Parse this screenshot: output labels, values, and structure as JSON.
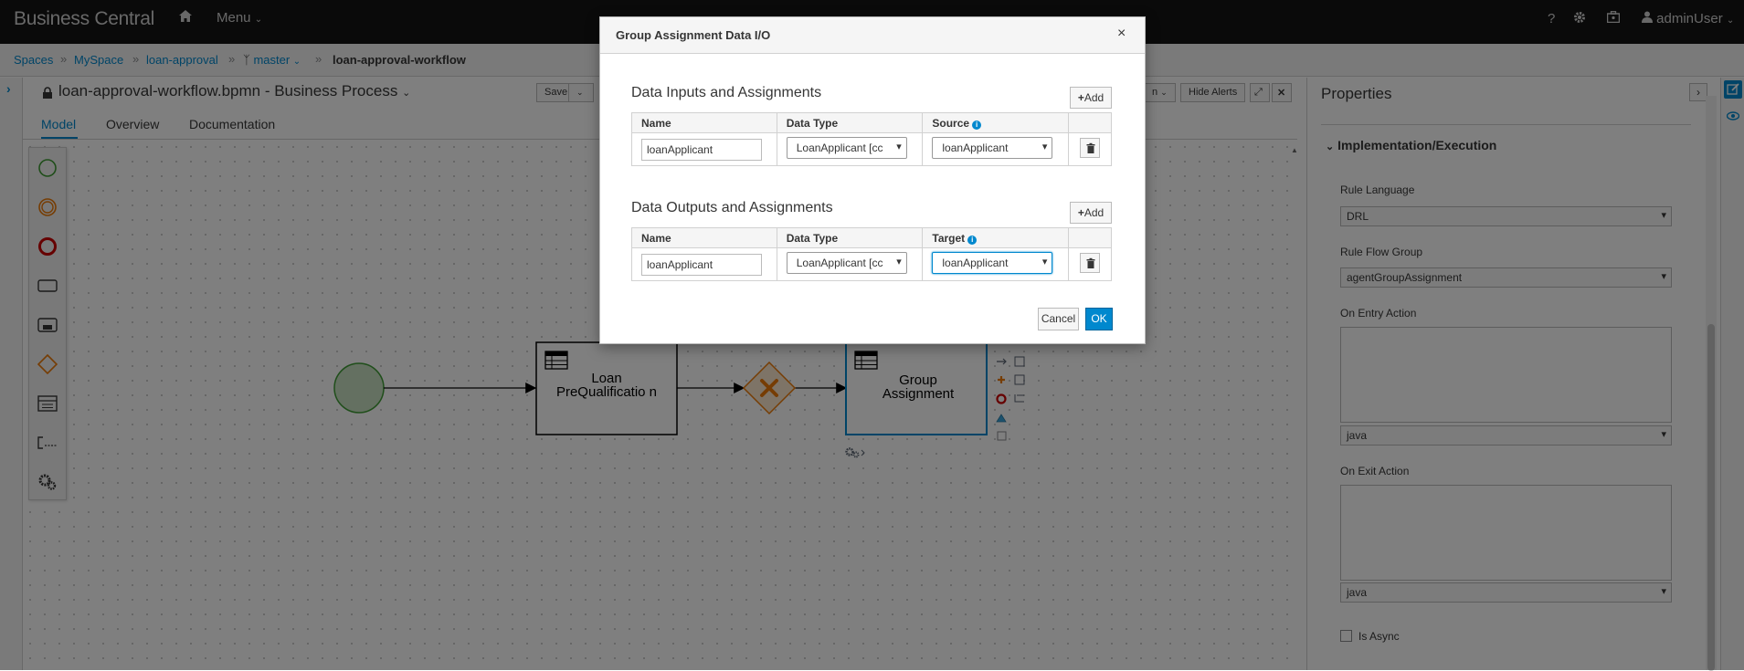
{
  "nav": {
    "brand": "Business Central",
    "menu_label": "Menu",
    "help_glyph": "?",
    "user": "adminUser",
    "icons": [
      "home-icon",
      "help-icon",
      "gear-icon",
      "briefcase-icon",
      "user-icon"
    ]
  },
  "breadcrumb": {
    "items": [
      "Spaces",
      "MySpace",
      "loan-approval",
      "master",
      "loan-approval-workflow"
    ]
  },
  "editor": {
    "title": "loan-approval-workflow.bpmn - Business Process",
    "save_label": "Save",
    "hide_alerts_label": "Hide Alerts",
    "partial_button_label": "n",
    "tabs": [
      "Model",
      "Overview",
      "Documentation"
    ]
  },
  "diagram": {
    "nodes": {
      "task1_label": "Loan PreQualificatio n",
      "task2_label": "Group Assignment"
    }
  },
  "properties": {
    "title": "Properties",
    "section": "Implementation/Execution",
    "rule_language_label": "Rule Language",
    "rule_language_value": "DRL",
    "rule_flow_group_label": "Rule Flow Group",
    "rule_flow_group_value": "agentGroupAssignment",
    "on_entry_label": "On Entry Action",
    "on_entry_lang": "java",
    "on_exit_label": "On Exit Action",
    "on_exit_lang": "java",
    "is_async_label": "Is Async"
  },
  "modal": {
    "title": "Group Assignment Data I/O",
    "inputs": {
      "title": "Data Inputs and Assignments",
      "add_label": "Add",
      "headers": [
        "Name",
        "Data Type",
        "Source"
      ],
      "row": {
        "name": "loanApplicant",
        "type": "LoanApplicant [cc",
        "source": "loanApplicant"
      }
    },
    "outputs": {
      "title": "Data Outputs and Assignments",
      "add_label": "Add",
      "headers": [
        "Name",
        "Data Type",
        "Target"
      ],
      "row": {
        "name": "loanApplicant",
        "type": "LoanApplicant [cc",
        "target": "loanApplicant"
      }
    },
    "cancel_label": "Cancel",
    "ok_label": "OK"
  },
  "colors": {
    "accent": "#0088ce",
    "start_event": "#3f9c35",
    "gateway": "#ec7a08",
    "end_event": "#cc0000"
  }
}
